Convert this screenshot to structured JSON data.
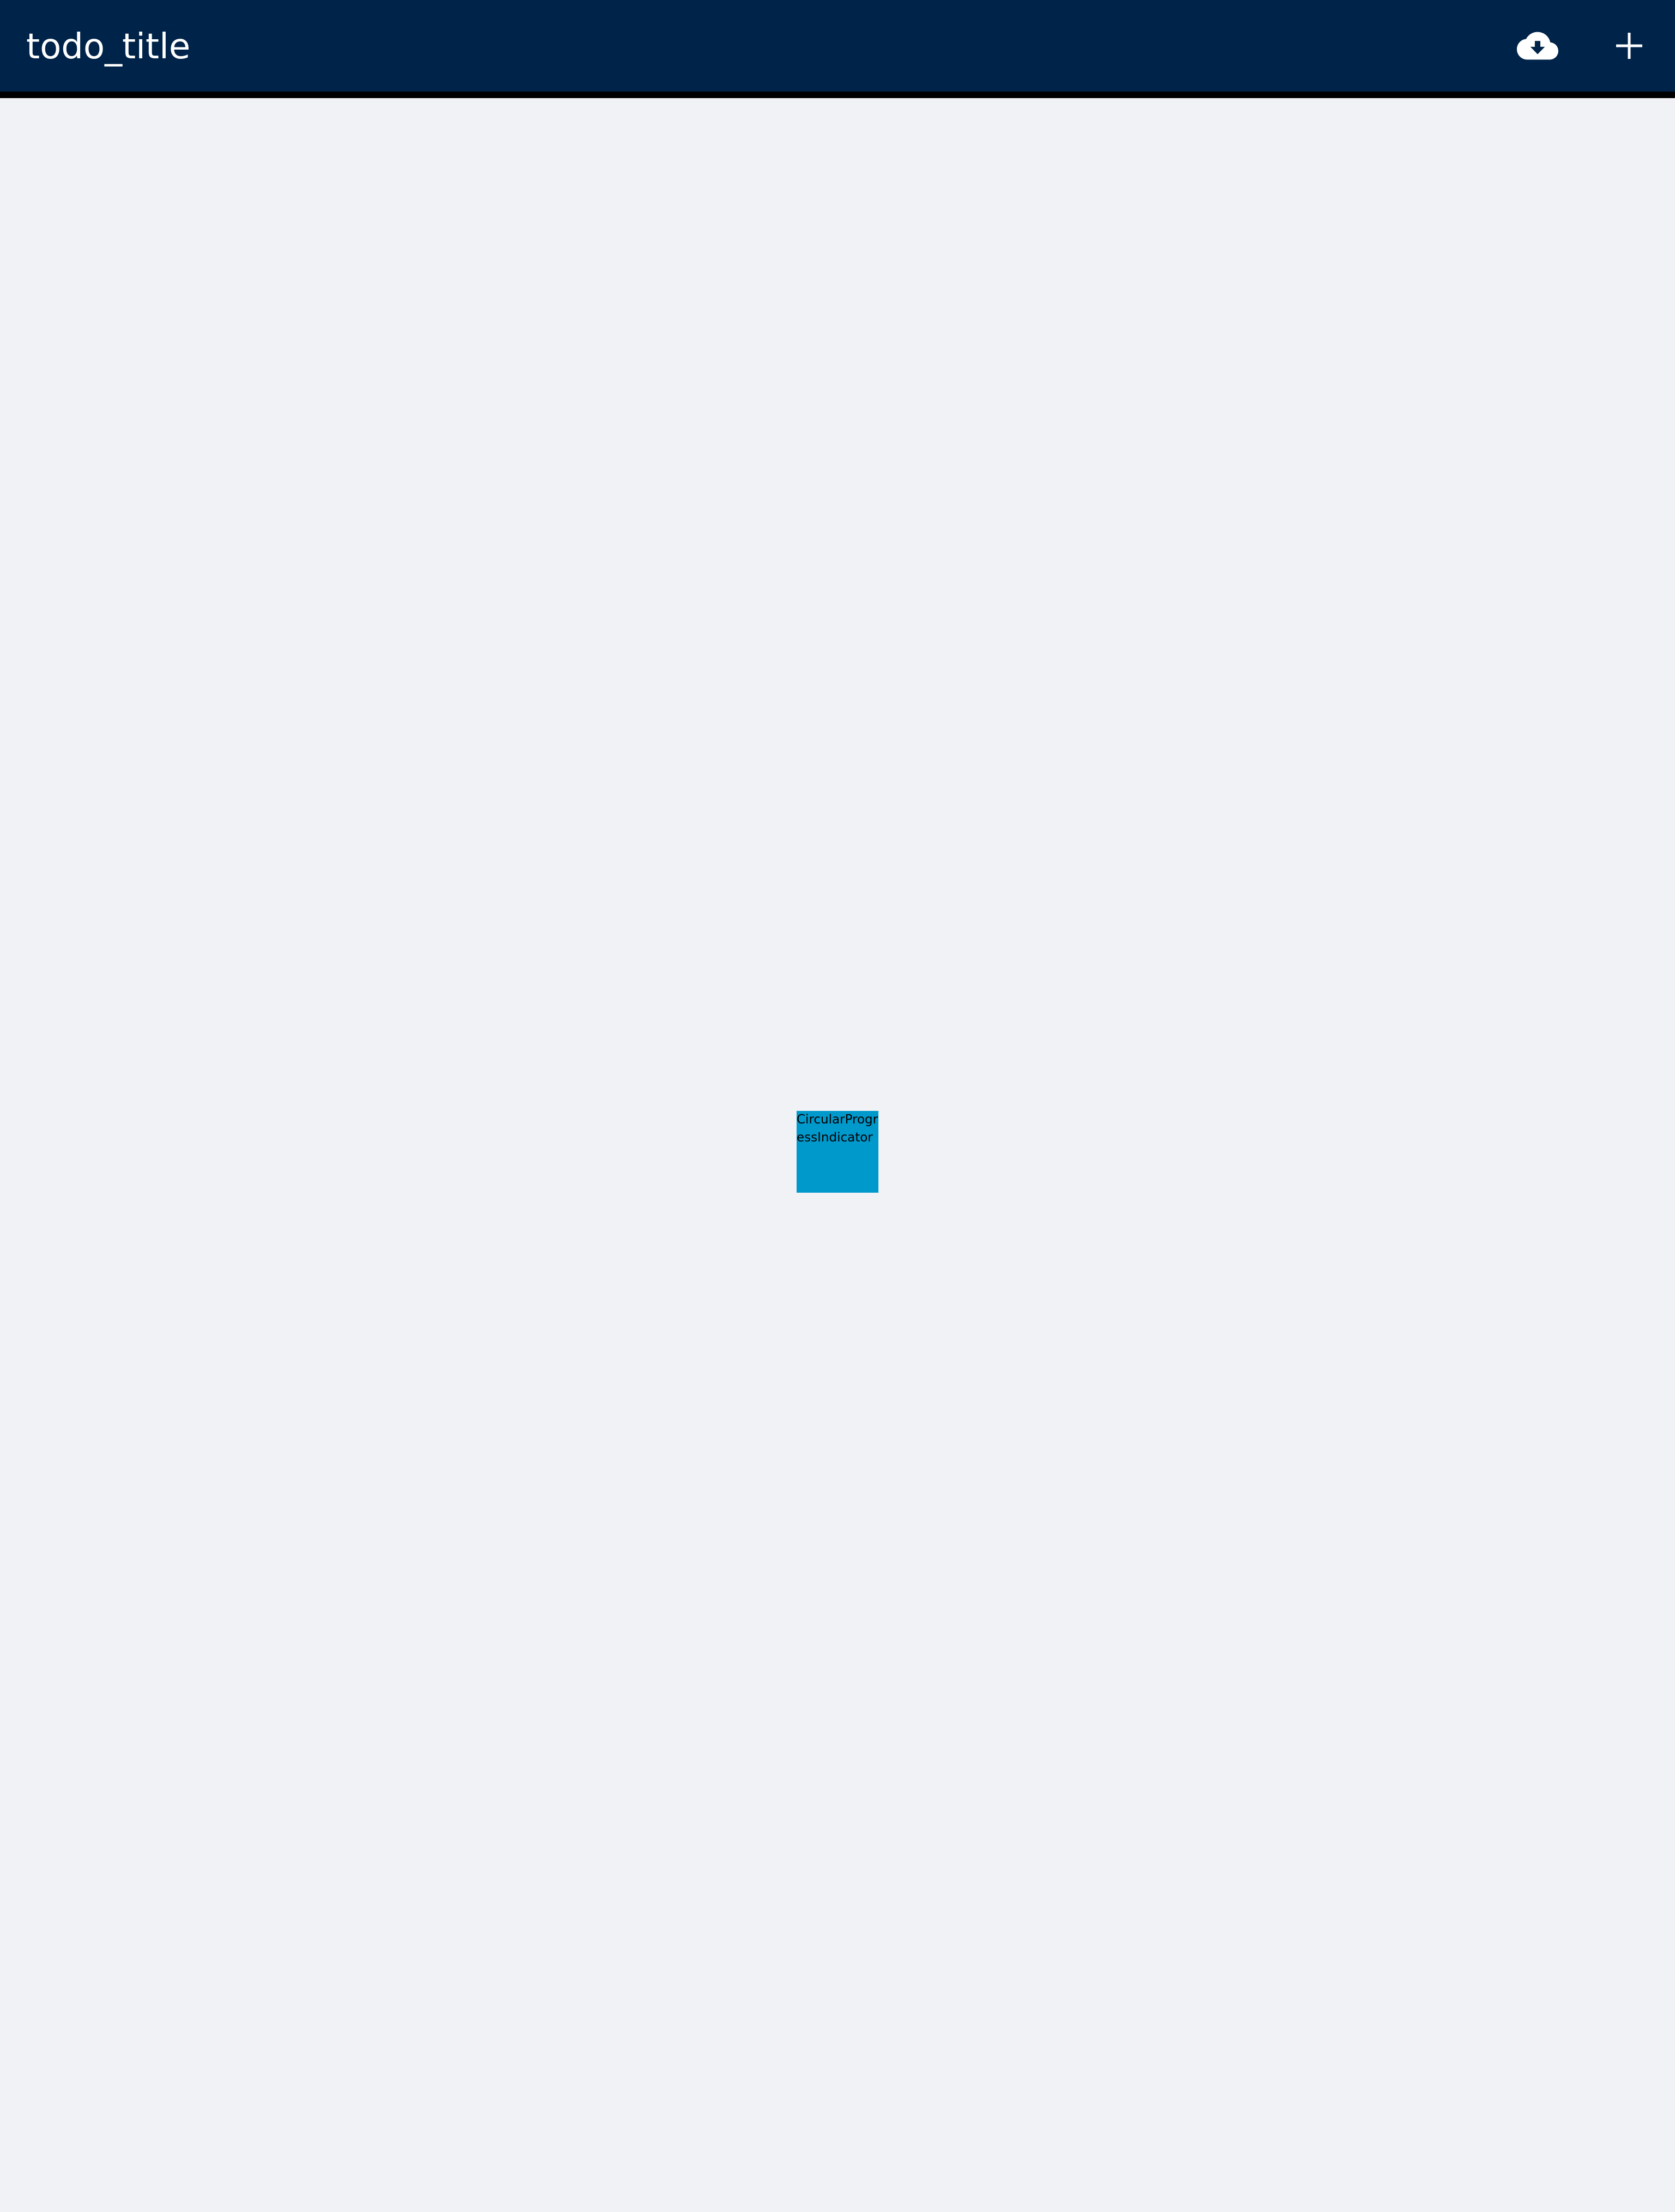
{
  "app_bar": {
    "title": "todo_title",
    "background_color": "#002349",
    "actions": [
      {
        "icon": "cloud-download-icon",
        "tooltip": ""
      },
      {
        "icon": "add-icon",
        "tooltip": ""
      }
    ]
  },
  "main": {
    "background_color": "#f0f2f5",
    "loading_indicator": {
      "label": "CircularProgressIndicator",
      "color": "#0099cc"
    }
  }
}
